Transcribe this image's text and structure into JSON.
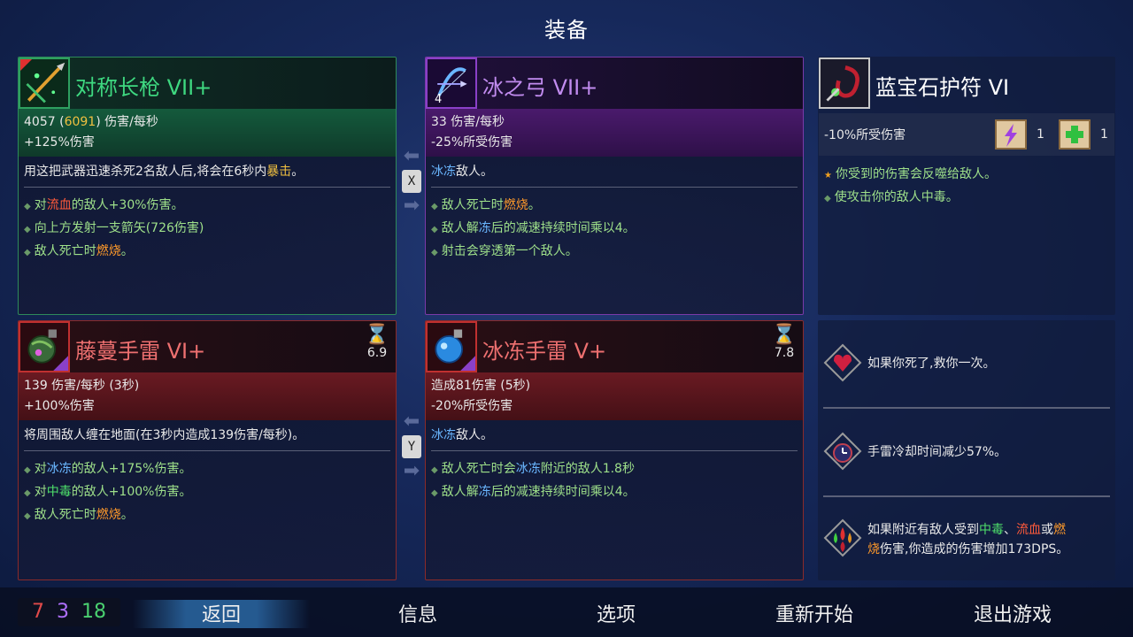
{
  "title": "装备",
  "melee": {
    "name": "对称长枪 VII+",
    "dps": "4057",
    "dps_crit": "6091",
    "dps_unit": "伤害/每秒",
    "bonus": "+125%伤害",
    "desc_a": "用这把武器迅速杀死2名敌人后,将会在6秒内",
    "desc_hl": "暴击",
    "desc_b": "。",
    "bullets": [
      {
        "a": "对",
        "hl": "流血",
        "b": "的敌人+30%伤害。"
      },
      {
        "a": "向上方发射一支箭矢(726伤害)",
        "hl": "",
        "b": ""
      },
      {
        "a": "敌人死亡时",
        "hl": "燃烧",
        "b": "。"
      }
    ]
  },
  "ranged": {
    "name": "冰之弓 VII+",
    "icon_count": "4",
    "dps": "33 伤害/每秒",
    "bonus": "-25%所受伤害",
    "desc_hl": "冰冻",
    "desc_b": "敌人。",
    "bullets": [
      {
        "a": "敌人死亡时",
        "hl": "燃烧",
        "b": "。"
      },
      {
        "a": "敌人解",
        "hl": "冻",
        "b": "后的减速持续时间乘以4。"
      },
      {
        "a": "射击会穿透第一个敌人。",
        "hl": "",
        "b": ""
      }
    ]
  },
  "amulet": {
    "name": "蓝宝石护符 VI",
    "stat": "-10%所受伤害",
    "scroll1_count": "1",
    "scroll2_count": "1",
    "bullets": [
      {
        "text": "你受到的伤害会反噬给敌人。",
        "star": true
      },
      {
        "text": "使攻击你的敌人中毒。",
        "star": false
      }
    ]
  },
  "skill1": {
    "name": "藤蔓手雷 VI+",
    "cooldown": "6.9",
    "stat1": "139 伤害/每秒 (3秒)",
    "stat2": "+100%伤害",
    "desc": "将周围敌人缠在地面(在3秒内造成139伤害/每秒)。",
    "bullets": [
      {
        "a": "对",
        "hl": "冰冻",
        "b": "的敌人+175%伤害。",
        "cls": "hl-ice"
      },
      {
        "a": "对",
        "hl": "中毒",
        "b": "的敌人+100%伤害。",
        "cls": "hl-green"
      },
      {
        "a": "敌人死亡时",
        "hl": "燃烧",
        "b": "。",
        "cls": "hl-orange"
      }
    ]
  },
  "skill2": {
    "name": "冰冻手雷 V+",
    "cooldown": "7.8",
    "stat1": "造成81伤害 (5秒)",
    "stat2": "-20%所受伤害",
    "desc_hl": "冰冻",
    "desc_b": "敌人。",
    "bullets": [
      {
        "a": "敌人死亡时会",
        "hl": "冰冻",
        "b": "附近的敌人1.8秒",
        "cls": "hl-ice"
      },
      {
        "a": "敌人解",
        "hl": "冻",
        "b": "后的减速持续时间乘以4。",
        "cls": "hl-ice"
      }
    ]
  },
  "swap_keys": {
    "top": "X",
    "bottom": "Y"
  },
  "mutations": [
    {
      "text": "如果你死了,救你一次。"
    },
    {
      "text": "手雷冷却时间减少57%。"
    },
    {
      "a": "如果附近有敌人受到",
      "poison": "中毒",
      "sep1": "、",
      "bleed": "流血",
      "sep2": "或",
      "burn1": "燃",
      "burn2": "烧",
      "b": "伤害,你造成的伤害增加173DPS。"
    }
  ],
  "stats_counter": {
    "brutality": "7",
    "tactics": "3",
    "survival": "18"
  },
  "menu": [
    "返回",
    "信息",
    "选项",
    "重新开始",
    "退出游戏"
  ],
  "colors": {
    "brutality": "#e04a4a",
    "tactics": "#b070ff",
    "survival": "#4ad070"
  }
}
